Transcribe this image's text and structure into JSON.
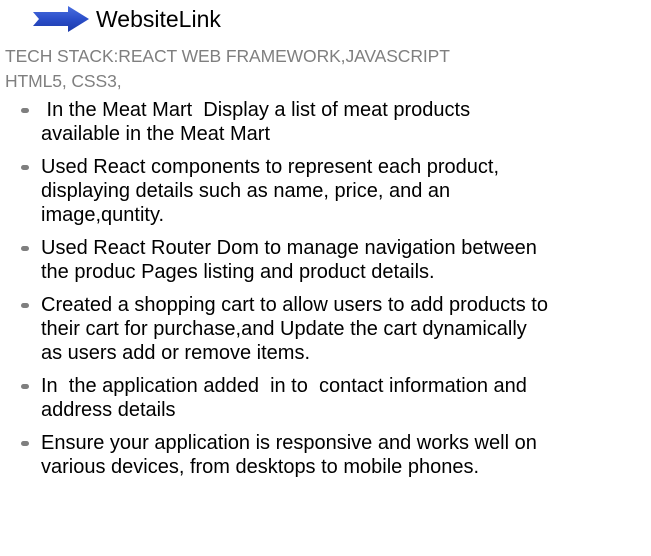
{
  "header": {
    "icon": "right-arrow-icon",
    "link_label": "WebsiteLink",
    "arrow_color": "#2b4ec9"
  },
  "tech_stack": {
    "line1": "TECH STACK:REACT WEB  FRAMEWORK,JAVASCRIPT",
    "line2": "HTML5, CSS3,"
  },
  "bullets": [
    {
      "lines": [
        " In the Meat Mart  Display a list of meat products",
        "available in the Meat Mart"
      ]
    },
    {
      "lines": [
        "Used React components to represent each product,",
        "displaying details such as name, price, and an",
        "image,quntity."
      ]
    },
    {
      "lines": [
        "Used React Router Dom to manage navigation between",
        "the produc Pages listing and product details."
      ]
    },
    {
      "lines": [
        "Created a shopping cart to allow users to add products to",
        "their cart for purchase,and Update the cart dynamically",
        "as users add or remove items."
      ]
    },
    {
      "lines": [
        "In  the application added  in to  contact information and",
        "address details"
      ]
    },
    {
      "lines": [
        "Ensure your application is responsive and works well on",
        "various devices, from desktops to mobile phones."
      ]
    }
  ]
}
